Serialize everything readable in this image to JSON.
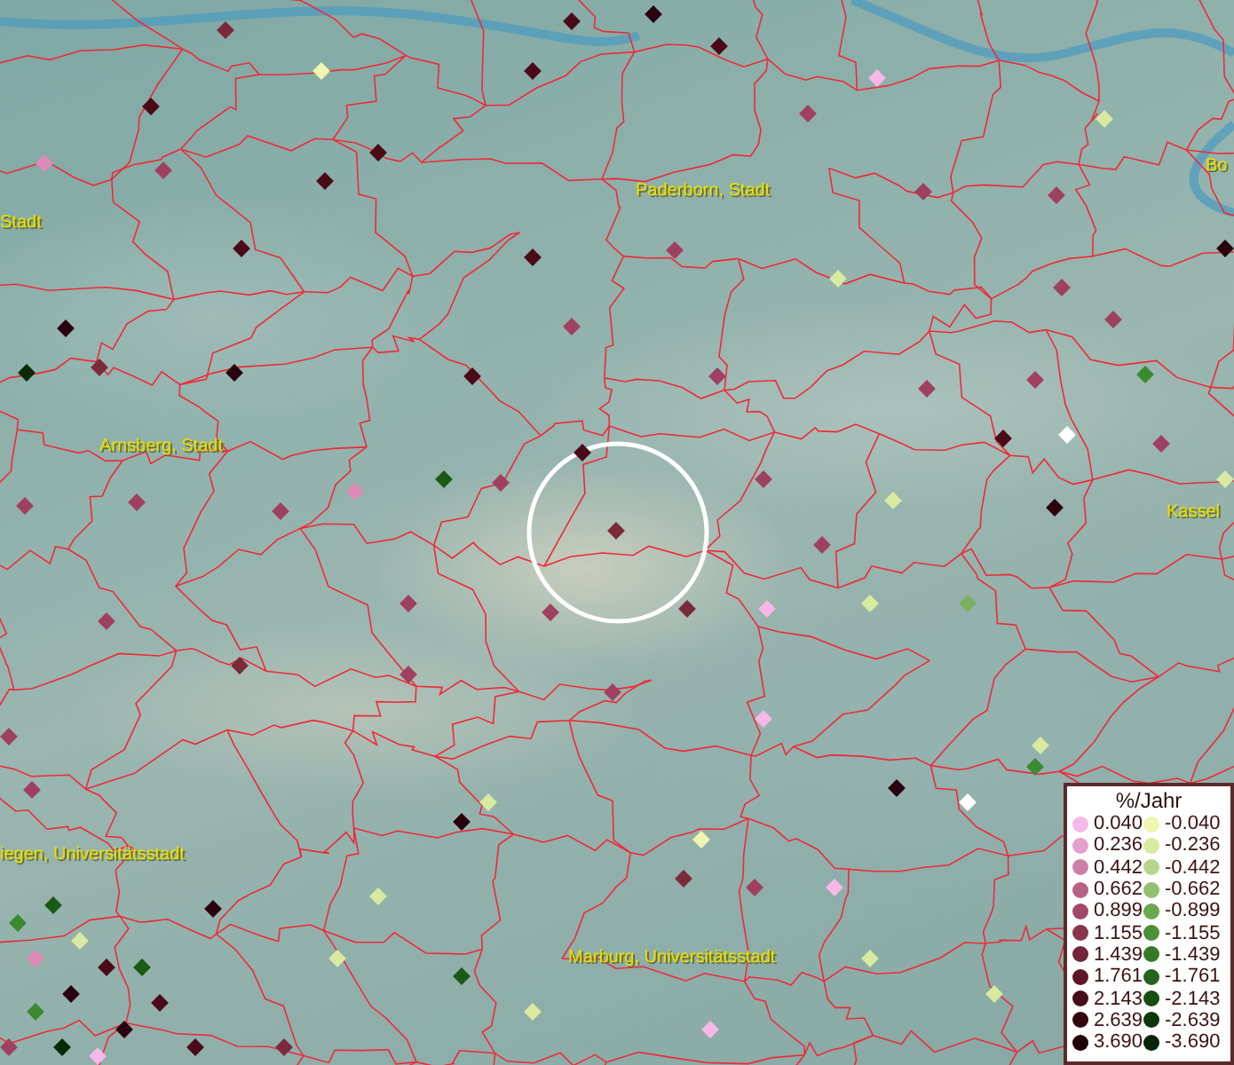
{
  "map": {
    "places": [
      {
        "name": "Stadt"
      },
      {
        "name": "Paderborn, Stadt"
      },
      {
        "name": "Bo"
      },
      {
        "name": "Arnsberg, Stadt"
      },
      {
        "name": "Kassel"
      },
      {
        "name": "iegen, Universitätsstadt"
      },
      {
        "name": "Marburg, Universitätsstadt"
      }
    ],
    "stations": [
      {
        "color": "#f0f5b0"
      },
      {
        "color": "#7a2a3a"
      },
      {
        "color": "#4a0a18"
      },
      {
        "color": "#e08ab8"
      },
      {
        "color": "#a04060"
      },
      {
        "color": "#4a0a18"
      },
      {
        "color": "#4a0a18"
      },
      {
        "color": "#4a0a18"
      },
      {
        "color": "#4a0a18"
      },
      {
        "color": "#4a0a18"
      },
      {
        "color": "#2a0010"
      },
      {
        "color": "#f6b8e6"
      },
      {
        "color": "#a04060"
      },
      {
        "color": "#d8eaa0"
      },
      {
        "color": "#a04060"
      },
      {
        "color": "#a04060"
      },
      {
        "color": "#2a0010"
      },
      {
        "color": "#4a0a18"
      },
      {
        "color": "#4a0a18"
      },
      {
        "color": "#a04060"
      },
      {
        "color": "#d8eaa0"
      },
      {
        "color": "#a04060"
      },
      {
        "color": "#a04060"
      },
      {
        "color": "#2a0010"
      },
      {
        "color": "#0a2a08"
      },
      {
        "color": "#7a2a3a"
      },
      {
        "color": "#2a0010"
      },
      {
        "color": "#4a0a18"
      },
      {
        "color": "#a04060"
      },
      {
        "color": "#a04060"
      },
      {
        "color": "#a04060"
      },
      {
        "color": "#a04060"
      },
      {
        "color": "#3a8a30"
      },
      {
        "color": "#ffffff"
      },
      {
        "color": "#4a0a18"
      },
      {
        "color": "#4a0a18"
      },
      {
        "color": "#1a5a14"
      },
      {
        "color": "#a04060"
      },
      {
        "color": "#e08ab8"
      },
      {
        "color": "#a04060"
      },
      {
        "color": "#a04060"
      },
      {
        "color": "#a04060"
      },
      {
        "color": "#7a2a3a"
      },
      {
        "color": "#7a2a3a"
      },
      {
        "color": "#f6b8e6"
      },
      {
        "color": "#a04060"
      },
      {
        "color": "#d8eaa0"
      },
      {
        "color": "#2a0010"
      },
      {
        "color": "#a04060"
      },
      {
        "color": "#d8eaa0"
      },
      {
        "color": "#a04060"
      },
      {
        "color": "#7ab060"
      },
      {
        "color": "#d8eaa0"
      },
      {
        "color": "#a04060"
      },
      {
        "color": "#a04060"
      },
      {
        "color": "#a04060"
      },
      {
        "color": "#7a2a3a"
      },
      {
        "color": "#a04060"
      },
      {
        "color": "#a04060"
      },
      {
        "color": "#f6b8e6"
      },
      {
        "color": "#2a0010"
      },
      {
        "color": "#ffffff"
      },
      {
        "color": "#3a8a30"
      },
      {
        "color": "#d8eaa0"
      },
      {
        "color": "#d8eaa0"
      },
      {
        "color": "#f0f5b0"
      },
      {
        "color": "#f6b8e6"
      },
      {
        "color": "#7a2a3a"
      },
      {
        "color": "#a04060"
      },
      {
        "color": "#d8eaa0"
      },
      {
        "color": "#2a0010"
      },
      {
        "color": "#2a0010"
      },
      {
        "color": "#a04060"
      },
      {
        "color": "#a04060"
      },
      {
        "color": "#d8eaa0"
      },
      {
        "color": "#d8eaa0"
      },
      {
        "color": "#d8eaa0"
      },
      {
        "color": "#1a5a14"
      },
      {
        "color": "#7a2a3a"
      },
      {
        "color": "#f6b8e6"
      },
      {
        "color": "#d8eaa0"
      },
      {
        "color": "#3a8a30"
      },
      {
        "color": "#1a5a14"
      },
      {
        "color": "#e08ab8"
      },
      {
        "color": "#2a0010"
      },
      {
        "color": "#4a0a18"
      },
      {
        "color": "#d8eaa0"
      },
      {
        "color": "#3a8a30"
      },
      {
        "color": "#2a0010"
      },
      {
        "color": "#4a0a18"
      },
      {
        "color": "#a04060"
      },
      {
        "color": "#0a2a08"
      },
      {
        "color": "#f6b8e6"
      },
      {
        "color": "#1a5a14"
      },
      {
        "color": "#4a0a18"
      }
    ]
  },
  "legend": {
    "title": "%/Jahr",
    "entries": [
      {
        "label": "0.040",
        "color": "#f6b8e6"
      },
      {
        "label": "-0.040",
        "color": "#f0f5b0"
      },
      {
        "label": "0.236",
        "color": "#e4a0cc"
      },
      {
        "label": "-0.236",
        "color": "#d8eaa0"
      },
      {
        "label": "0.442",
        "color": "#cc80a8"
      },
      {
        "label": "-0.442",
        "color": "#b4d888"
      },
      {
        "label": "0.662",
        "color": "#b86088"
      },
      {
        "label": "-0.662",
        "color": "#90c070"
      },
      {
        "label": "0.899",
        "color": "#a04868"
      },
      {
        "label": "-0.899",
        "color": "#6aa850"
      },
      {
        "label": "1.155",
        "color": "#8a3450"
      },
      {
        "label": "-1.155",
        "color": "#4a9038"
      },
      {
        "label": "1.439",
        "color": "#74243c"
      },
      {
        "label": "-1.439",
        "color": "#367a28"
      },
      {
        "label": "1.761",
        "color": "#5e1628"
      },
      {
        "label": "-1.761",
        "color": "#24641c"
      },
      {
        "label": "2.143",
        "color": "#480c1a"
      },
      {
        "label": "-2.143",
        "color": "#164e12"
      },
      {
        "label": "2.639",
        "color": "#32060e"
      },
      {
        "label": "-2.639",
        "color": "#0c380a"
      },
      {
        "label": "3.690",
        "color": "#1e0206"
      },
      {
        "label": "-3.690",
        "color": "#062406"
      }
    ]
  }
}
